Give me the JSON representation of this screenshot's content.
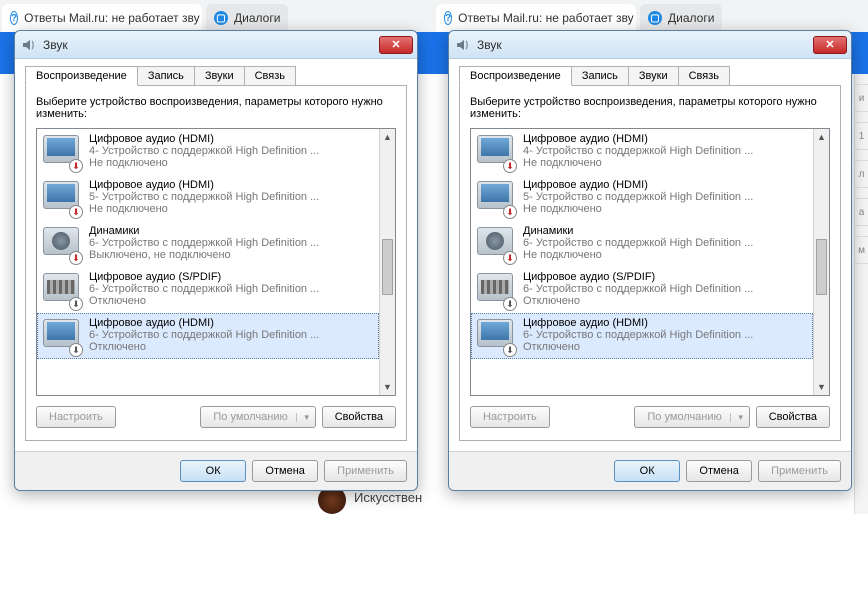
{
  "browser": {
    "tab1": {
      "label": "Ответы Mail.ru: не работает зву"
    },
    "tab2": {
      "label": "Диалоги"
    }
  },
  "dialog": {
    "title": "Звук",
    "tabs": {
      "playback": "Воспроизведение",
      "recording": "Запись",
      "sounds": "Звуки",
      "comm": "Связь"
    },
    "instruction": "Выберите устройство воспроизведения, параметры которого нужно изменить:",
    "buttons": {
      "configure": "Настроить",
      "default": "По умолчанию",
      "properties": "Свойства",
      "ok": "ОК",
      "cancel": "Отмена",
      "apply": "Применить"
    }
  },
  "left_devices": [
    {
      "icon": "monitor",
      "badge": "down",
      "title": "Цифровое аудио (HDMI)",
      "sub": "4- Устройство с поддержкой High Definition ...",
      "status": "Не подключено"
    },
    {
      "icon": "monitor",
      "badge": "down",
      "title": "Цифровое аудио (HDMI)",
      "sub": "5- Устройство с поддержкой High Definition ...",
      "status": "Не подключено"
    },
    {
      "icon": "speaker",
      "badge": "down",
      "title": "Динамики",
      "sub": "6- Устройство с поддержкой High Definition ...",
      "status": "Выключено, не подключено"
    },
    {
      "icon": "spdif",
      "badge": "off",
      "title": "Цифровое аудио (S/PDIF)",
      "sub": "6- Устройство с поддержкой High Definition ...",
      "status": "Отключено"
    },
    {
      "icon": "monitor",
      "badge": "off",
      "title": "Цифровое аудио (HDMI)",
      "sub": "6- Устройство с поддержкой High Definition ...",
      "status": "Отключено"
    }
  ],
  "right_devices": [
    {
      "icon": "monitor",
      "badge": "down",
      "title": "Цифровое аудио (HDMI)",
      "sub": "4- Устройство с поддержкой High Definition ...",
      "status": "Не подключено"
    },
    {
      "icon": "monitor",
      "badge": "down",
      "title": "Цифровое аудио (HDMI)",
      "sub": "5- Устройство с поддержкой High Definition ...",
      "status": "Не подключено"
    },
    {
      "icon": "speaker",
      "badge": "down",
      "title": "Динамики",
      "sub": "6- Устройство с поддержкой High Definition ...",
      "status": "Не подключено"
    },
    {
      "icon": "spdif",
      "badge": "off",
      "title": "Цифровое аудио (S/PDIF)",
      "sub": "6- Устройство с поддержкой High Definition ...",
      "status": "Отключено"
    },
    {
      "icon": "monitor",
      "badge": "off",
      "title": "Цифровое аудио (HDMI)",
      "sub": "6- Устройство с поддержкой High Definition ...",
      "status": "Отключено"
    }
  ],
  "bg": {
    "avatar_label": "Искусствен"
  }
}
